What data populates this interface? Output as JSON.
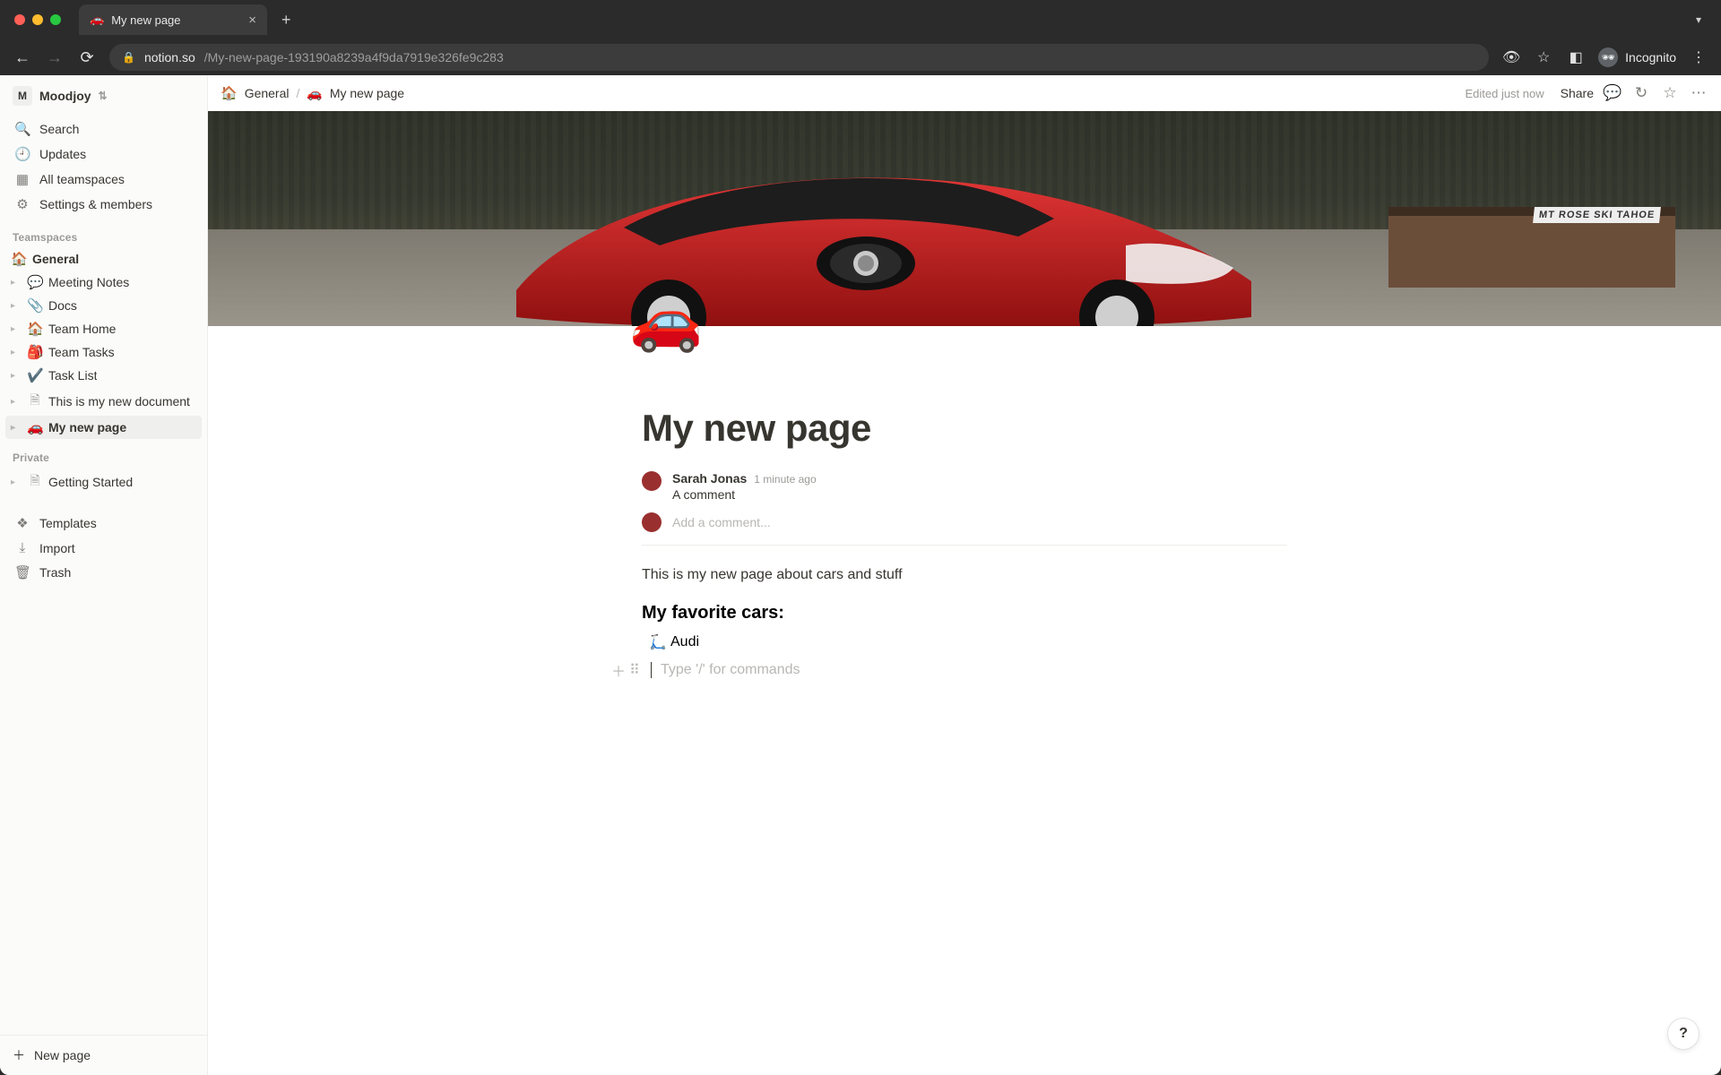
{
  "browser": {
    "tab_icon": "🚗",
    "tab_title": "My new page",
    "url_host": "notion.so",
    "url_path": "/My-new-page-193190a8239a4f9da7919e326fe9c283",
    "profile_label": "Incognito"
  },
  "workspace": {
    "initial": "M",
    "name": "Moodjoy"
  },
  "sidebar_nav": {
    "search": "Search",
    "updates": "Updates",
    "all_teamspaces": "All teamspaces",
    "settings": "Settings & members"
  },
  "sections": {
    "teamspaces": "Teamspaces",
    "private": "Private"
  },
  "tree": {
    "general": {
      "icon": "🏠",
      "label": "General"
    },
    "items": [
      {
        "icon": "💬",
        "label": "Meeting Notes"
      },
      {
        "icon": "📎",
        "label": "Docs"
      },
      {
        "icon": "🏠",
        "label": "Team Home"
      },
      {
        "icon": "🎒",
        "label": "Team Tasks"
      },
      {
        "icon": "✔️",
        "label": "Task List"
      },
      {
        "icon": "doc",
        "label": "This is my new document"
      },
      {
        "icon": "🚗",
        "label": "My new page",
        "active": true
      }
    ],
    "private_items": [
      {
        "icon": "doc",
        "label": "Getting Started"
      }
    ]
  },
  "sidebar_footer": {
    "templates": "Templates",
    "import": "Import",
    "trash": "Trash",
    "new_page": "New page"
  },
  "breadcrumb": {
    "root_icon": "🏠",
    "root": "General",
    "page_icon": "🚗",
    "page": "My new page"
  },
  "topbar": {
    "status": "Edited just now",
    "share": "Share"
  },
  "cover": {
    "sign_text": "MT ROSE SKI TAHOE"
  },
  "page": {
    "icon": "🚗",
    "title": "My new page",
    "paragraph": "This is my new page about cars and stuff",
    "heading": "My favorite cars:",
    "list": [
      "Audi"
    ],
    "new_block_placeholder": "Type '/' for commands"
  },
  "comments": {
    "author": "Sarah Jonas",
    "time": "1 minute ago",
    "body": "A comment",
    "add_placeholder": "Add a comment..."
  },
  "help": "?"
}
